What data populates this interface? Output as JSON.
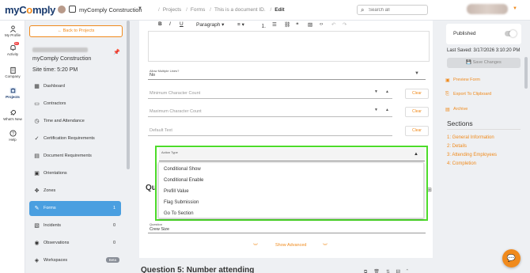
{
  "app": {
    "logo_text_1": "myC",
    "logo_text_2": "o",
    "logo_text_3": "mply"
  },
  "org": {
    "name": "myComply Construction"
  },
  "breadcrumb": {
    "items": [
      "Projects",
      "Forms",
      "This is a document ID.",
      "Edit"
    ]
  },
  "search": {
    "placeholder": "Search all"
  },
  "rail": {
    "items": [
      {
        "label": "My Profile",
        "icon": "person-icon"
      },
      {
        "label": "Activity",
        "icon": "bell-icon",
        "badge": "16"
      },
      {
        "label": "Company",
        "icon": "building-icon"
      },
      {
        "label": "Projects",
        "icon": "projects-icon"
      },
      {
        "label": "What's New",
        "icon": "rocket-icon"
      },
      {
        "label": "Help",
        "icon": "help-icon"
      }
    ]
  },
  "sidebar": {
    "back_label": "Back to Projects",
    "project_name": "myComply Construction",
    "site_time": "Site time: 5:20 PM",
    "nav": [
      {
        "label": "Dashboard",
        "icon": "dashboard-icon",
        "count": ""
      },
      {
        "label": "Contractors",
        "icon": "briefcase-icon",
        "count": ""
      },
      {
        "label": "Time and Attendance",
        "icon": "clock-icon",
        "count": ""
      },
      {
        "label": "Certification Requirements",
        "icon": "check-circle-icon",
        "count": ""
      },
      {
        "label": "Document Requirements",
        "icon": "document-icon",
        "count": ""
      },
      {
        "label": "Orientations",
        "icon": "orientation-icon",
        "count": ""
      },
      {
        "label": "Zones",
        "icon": "zones-icon",
        "count": ""
      },
      {
        "label": "Forms",
        "icon": "pen-icon",
        "count": "1"
      },
      {
        "label": "Incidents",
        "icon": "incident-icon",
        "count": "0"
      },
      {
        "label": "Observations",
        "icon": "eye-icon",
        "count": "0"
      },
      {
        "label": "Workspaces",
        "icon": "layers-icon",
        "count": "",
        "badge": "Beta"
      }
    ]
  },
  "editor": {
    "paragraph_label": "Paragraph",
    "allow_multiple": {
      "label": "Allow Multiple Lines?",
      "value": "No"
    },
    "min_count": {
      "placeholder": "Minimum Character Count"
    },
    "max_count": {
      "placeholder": "Maximum Character Count"
    },
    "default_text": {
      "placeholder": "Default Text"
    },
    "clear_label": "Clear",
    "action_type": {
      "label": "Action Type"
    },
    "dropdown_options": [
      "Conditional Show",
      "Conditional Enable",
      "Prefill Value",
      "Flag Submission",
      "Go To Section"
    ],
    "question_partial": "Qu",
    "crew": {
      "label": "Question",
      "value": "Crew Size"
    },
    "show_advanced": "Show Advanced",
    "question5": "Question 5: Number attending"
  },
  "right": {
    "published_label": "Published",
    "last_saved": "Last Saved: 3/17/2026 3:10:20 PM",
    "save_label": "Save Changes",
    "links": [
      {
        "label": "Preview Form",
        "icon": "preview-icon"
      },
      {
        "label": "Export To Clipboard",
        "icon": "export-icon"
      },
      {
        "label": "Archive",
        "icon": "archive-icon"
      }
    ],
    "sections_title": "Sections",
    "sections": [
      "1: General Information",
      "2: Details",
      "3: Attending Employees",
      "4: Completion"
    ]
  },
  "colors": {
    "accent": "#f08a1c",
    "active_nav": "#4a9fe0",
    "highlight": "#4ddc2a",
    "brand": "#1a3b6e"
  }
}
